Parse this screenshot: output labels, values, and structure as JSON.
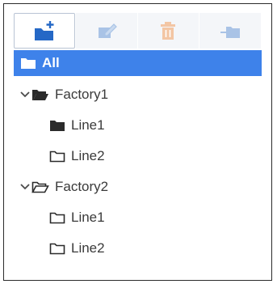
{
  "toolbar": {
    "buttons": [
      {
        "name": "add-folder",
        "icon": "folder-plus-icon",
        "state": "enabled",
        "color": "#2568c6"
      },
      {
        "name": "edit",
        "icon": "edit-icon",
        "state": "disabled",
        "color": "#a9c3e6"
      },
      {
        "name": "delete",
        "icon": "trash-icon",
        "state": "disabled",
        "color": "#f3c6a4"
      },
      {
        "name": "move",
        "icon": "move-to-folder-icon",
        "state": "disabled",
        "color": "#a9c3e6"
      }
    ]
  },
  "tree": {
    "root": {
      "label": "All",
      "icon": "folder-icon",
      "selected": true,
      "selected_color": "#3e82ea"
    },
    "nodes": [
      {
        "label": "Factory1",
        "icon": "folder-open-filled-icon",
        "expanded": true,
        "children": [
          {
            "label": "Line1",
            "icon": "folder-filled-icon"
          },
          {
            "label": "Line2",
            "icon": "folder-outline-icon"
          }
        ]
      },
      {
        "label": "Factory2",
        "icon": "folder-open-outline-icon",
        "expanded": true,
        "children": [
          {
            "label": "Line1",
            "icon": "folder-outline-icon"
          },
          {
            "label": "Line2",
            "icon": "folder-outline-icon"
          }
        ]
      }
    ]
  }
}
